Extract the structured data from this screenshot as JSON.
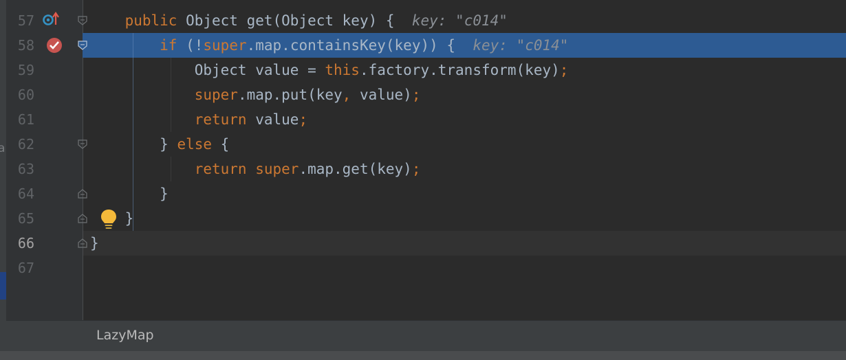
{
  "editor": {
    "lines": [
      {
        "number": "57",
        "tokens": [
          {
            "t": "    ",
            "c": "plain"
          },
          {
            "t": "public ",
            "c": "kw"
          },
          {
            "t": "Object get(Object key) {  ",
            "c": "plain"
          },
          {
            "t": "key: ",
            "c": "hint"
          },
          {
            "t": "\"c014\"",
            "c": "hint-str"
          }
        ]
      },
      {
        "number": "58",
        "tokens": [
          {
            "t": "        ",
            "c": "plain"
          },
          {
            "t": "if ",
            "c": "kw"
          },
          {
            "t": "(!",
            "c": "plain"
          },
          {
            "t": "super",
            "c": "kw"
          },
          {
            "t": ".map.containsKey(key)) {  ",
            "c": "plain"
          },
          {
            "t": "key: ",
            "c": "hint"
          },
          {
            "t": "\"c014\"",
            "c": "hint-str"
          }
        ]
      },
      {
        "number": "59",
        "tokens": [
          {
            "t": "            Object value = ",
            "c": "plain"
          },
          {
            "t": "this",
            "c": "kw"
          },
          {
            "t": ".factory.transform(key)",
            "c": "plain"
          },
          {
            "t": ";",
            "c": "kw"
          }
        ]
      },
      {
        "number": "60",
        "tokens": [
          {
            "t": "            ",
            "c": "plain"
          },
          {
            "t": "super",
            "c": "kw"
          },
          {
            "t": ".map.put(key",
            "c": "plain"
          },
          {
            "t": ", ",
            "c": "kw"
          },
          {
            "t": "value)",
            "c": "plain"
          },
          {
            "t": ";",
            "c": "kw"
          }
        ]
      },
      {
        "number": "61",
        "tokens": [
          {
            "t": "            ",
            "c": "plain"
          },
          {
            "t": "return ",
            "c": "kw"
          },
          {
            "t": "value",
            "c": "plain"
          },
          {
            "t": ";",
            "c": "kw"
          }
        ]
      },
      {
        "number": "62",
        "tokens": [
          {
            "t": "        } ",
            "c": "plain"
          },
          {
            "t": "else ",
            "c": "kw"
          },
          {
            "t": "{",
            "c": "plain"
          }
        ]
      },
      {
        "number": "63",
        "tokens": [
          {
            "t": "            ",
            "c": "plain"
          },
          {
            "t": "return super",
            "c": "kw"
          },
          {
            "t": ".map.get(key)",
            "c": "plain"
          },
          {
            "t": ";",
            "c": "kw"
          }
        ]
      },
      {
        "number": "64",
        "tokens": [
          {
            "t": "        }",
            "c": "plain"
          }
        ]
      },
      {
        "number": "65",
        "tokens": [
          {
            "t": "    }",
            "c": "plain"
          }
        ]
      },
      {
        "number": "66",
        "tokens": [
          {
            "t": "}",
            "c": "plain"
          }
        ]
      },
      {
        "number": "67",
        "tokens": []
      }
    ],
    "execution_line": "58",
    "current_line": "66",
    "gutter_icons": [
      {
        "line": "57",
        "icon": "override-method-icon"
      },
      {
        "line": "58",
        "icon": "breakpoint-icon"
      },
      {
        "line": "65",
        "icon": "intention-bulb-icon"
      }
    ],
    "colors": {
      "keyword": "#cc7832",
      "plain": "#a9b7c6",
      "inlay_hint": "#8a8f95",
      "execution_highlight": "#2d5b93",
      "breakpoint": "#c75450"
    }
  },
  "status_bar": {
    "breadcrumb": "LazyMap"
  },
  "left_panel": {
    "cut_letter": "a"
  }
}
